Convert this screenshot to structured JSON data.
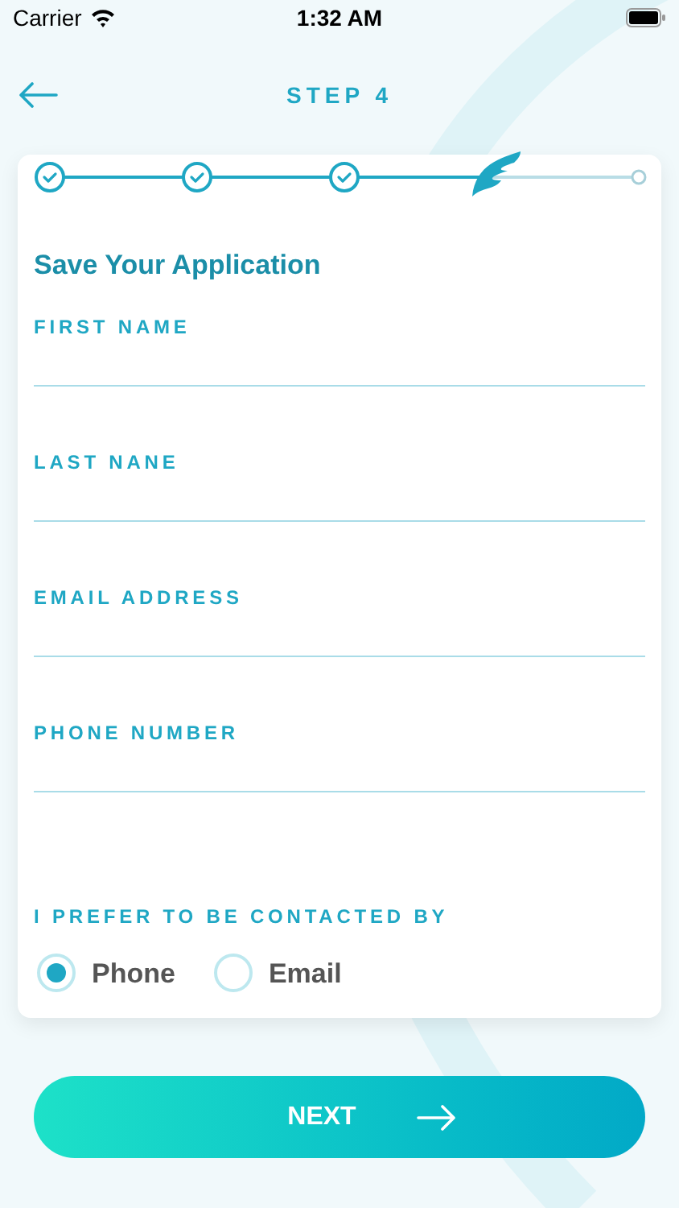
{
  "status_bar": {
    "carrier": "Carrier",
    "time": "1:32 AM"
  },
  "header": {
    "title": "STEP 4"
  },
  "steps": [
    {
      "kind": "done"
    },
    {
      "kind": "done"
    },
    {
      "kind": "done"
    },
    {
      "kind": "current"
    },
    {
      "kind": "pending"
    }
  ],
  "form": {
    "title": "Save Your Application",
    "fields": [
      {
        "label": "FIRST NAME"
      },
      {
        "label": "LAST NANE"
      },
      {
        "label": "EMAIL ADDRESS"
      },
      {
        "label": "PHONE NUMBER"
      }
    ],
    "contact": {
      "label": "I PREFER TO BE CONTACTED BY",
      "options": [
        {
          "label": "Phone",
          "selected": true
        },
        {
          "label": "Email",
          "selected": false
        }
      ]
    }
  },
  "next_button": {
    "label": "NEXT"
  }
}
